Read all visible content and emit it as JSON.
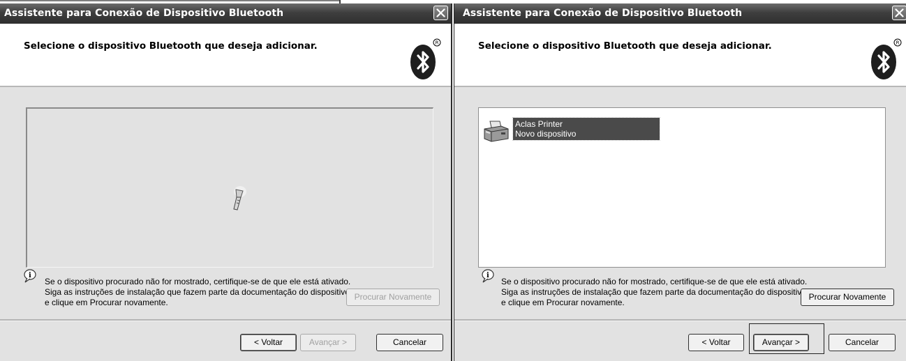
{
  "left_dialog": {
    "title": "Assistente para Conexão de Dispositivo Bluetooth",
    "header_title": "Selecione o dispositivo Bluetooth que deseja adicionar.",
    "info_text": "Se o dispositivo procurado não for mostrado, certifique-se de que ele está ativado. Siga as instruções de instalação que fazem parte da documentação do dispositivo e clique em Procurar novamente.",
    "search_again_label": "Procurar Novamente",
    "back_label": "< Voltar",
    "next_label": "Avançar >",
    "cancel_label": "Cancelar",
    "state": "searching"
  },
  "right_dialog": {
    "title": "Assistente para Conexão de Dispositivo Bluetooth",
    "header_title": "Selecione o dispositivo Bluetooth que deseja adicionar.",
    "devices": [
      {
        "name": "Aclas Printer",
        "status": "Novo dispositivo",
        "icon": "printer-icon",
        "selected": true
      }
    ],
    "info_text": "Se o dispositivo procurado não for mostrado, certifique-se de que ele está ativado. Siga as instruções de instalação que fazem parte da documentação do dispositivo e clique em Procurar novamente.",
    "search_again_label": "Procurar Novamente",
    "back_label": "< Voltar",
    "next_label": "Avançar >",
    "cancel_label": "Cancelar"
  },
  "icons": {
    "bluetooth_logo": "bluetooth-logo-icon",
    "close": "close-icon",
    "info": "info-icon",
    "searching": "searching-flashlight-icon",
    "printer": "printer-icon"
  },
  "colors": {
    "titlebar": "#3e3e3e",
    "dialog_bg": "#e2e2e2",
    "selection": "#4a4a4a"
  }
}
